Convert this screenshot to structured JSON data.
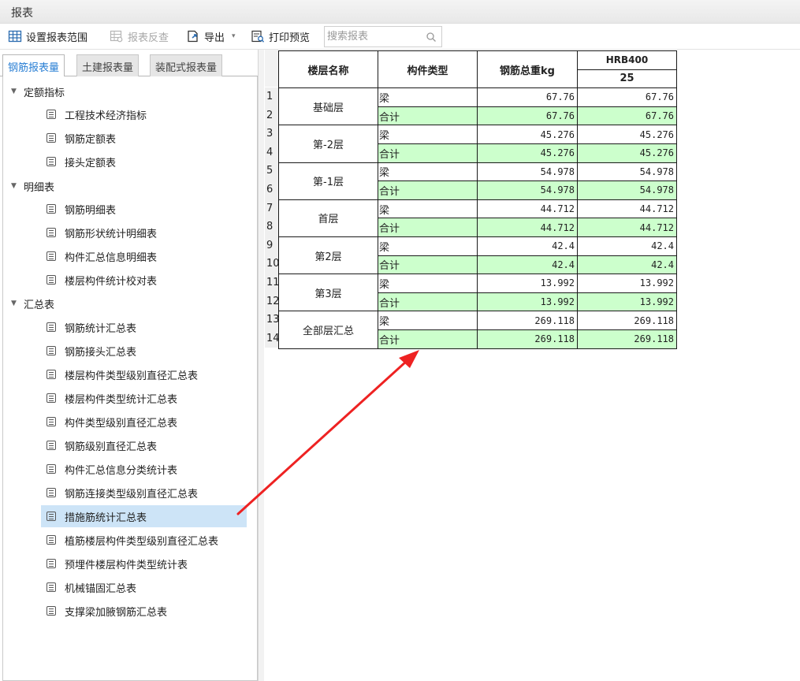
{
  "window": {
    "title": "报表"
  },
  "toolbar": {
    "set_range": "设置报表范围",
    "reverse_check": "报表反查",
    "export": "导出",
    "print_preview": "打印预览",
    "search_placeholder": "搜索报表"
  },
  "tabs": [
    "钢筋报表量",
    "土建报表量",
    "装配式报表量"
  ],
  "tree": {
    "group1": {
      "label": "定额指标",
      "items": [
        "工程技术经济指标",
        "钢筋定额表",
        "接头定额表"
      ]
    },
    "group2": {
      "label": "明细表",
      "items": [
        "钢筋明细表",
        "钢筋形状统计明细表",
        "构件汇总信息明细表",
        "楼层构件统计校对表"
      ]
    },
    "group3": {
      "label": "汇总表",
      "items": [
        "钢筋统计汇总表",
        "钢筋接头汇总表",
        "楼层构件类型级别直径汇总表",
        "楼层构件类型统计汇总表",
        "构件类型级别直径汇总表",
        "钢筋级别直径汇总表",
        "构件汇总信息分类统计表",
        "钢筋连接类型级别直径汇总表",
        "措施筋统计汇总表",
        "植筋楼层构件类型级别直径汇总表",
        "预埋件楼层构件类型统计表",
        "机械锚固汇总表",
        "支撑梁加腋钢筋汇总表"
      ]
    }
  },
  "table": {
    "headers": {
      "floor": "楼层名称",
      "type": "构件类型",
      "total": "钢筋总重kg",
      "grade": "HRB400",
      "dia": "25"
    },
    "rownums": [
      "1",
      "2",
      "3",
      "4",
      "5",
      "6",
      "7",
      "8",
      "9",
      "10",
      "11",
      "12",
      "13",
      "14"
    ],
    "floors": [
      {
        "name": "基础层",
        "beam": "梁",
        "beam_total": "67.76",
        "beam_25": "67.76",
        "sum": "合计",
        "sum_total": "67.76",
        "sum_25": "67.76"
      },
      {
        "name": "第-2层",
        "beam": "梁",
        "beam_total": "45.276",
        "beam_25": "45.276",
        "sum": "合计",
        "sum_total": "45.276",
        "sum_25": "45.276"
      },
      {
        "name": "第-1层",
        "beam": "梁",
        "beam_total": "54.978",
        "beam_25": "54.978",
        "sum": "合计",
        "sum_total": "54.978",
        "sum_25": "54.978"
      },
      {
        "name": "首层",
        "beam": "梁",
        "beam_total": "44.712",
        "beam_25": "44.712",
        "sum": "合计",
        "sum_total": "44.712",
        "sum_25": "44.712"
      },
      {
        "name": "第2层",
        "beam": "梁",
        "beam_total": "42.4",
        "beam_25": "42.4",
        "sum": "合计",
        "sum_total": "42.4",
        "sum_25": "42.4"
      },
      {
        "name": "第3层",
        "beam": "梁",
        "beam_total": "13.992",
        "beam_25": "13.992",
        "sum": "合计",
        "sum_total": "13.992",
        "sum_25": "13.992"
      },
      {
        "name": "全部层汇总",
        "beam": "梁",
        "beam_total": "269.118",
        "beam_25": "269.118",
        "sum": "合计",
        "sum_total": "269.118",
        "sum_25": "269.118"
      }
    ]
  },
  "colors": {
    "accent": "#2a7fd4",
    "selected_row": "#cde4f7",
    "total_row": "#ccffcc",
    "annotation_arrow": "#ee2222"
  }
}
